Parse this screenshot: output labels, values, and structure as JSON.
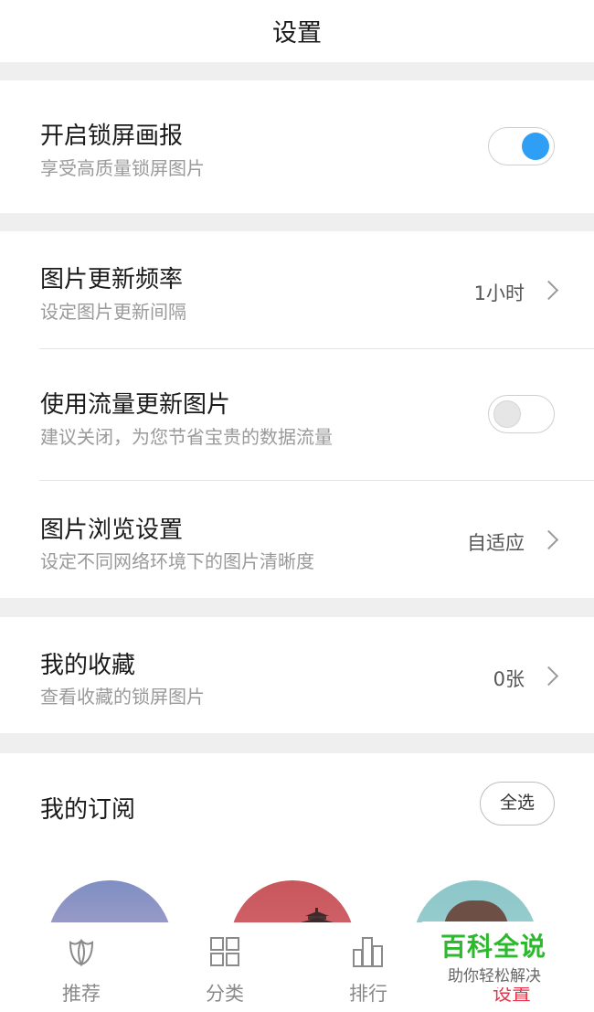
{
  "header": {
    "title": "设置"
  },
  "lockscreen": {
    "title": "开启锁屏画报",
    "subtitle": "享受高质量锁屏图片",
    "enabled": true
  },
  "update_frequency": {
    "title": "图片更新频率",
    "subtitle": "设定图片更新间隔",
    "value": "1小时"
  },
  "mobile_data": {
    "title": "使用流量更新图片",
    "subtitle": "建议关闭，为您节省宝贵的数据流量",
    "enabled": false
  },
  "browse_settings": {
    "title": "图片浏览设置",
    "subtitle": "设定不同网络环境下的图片清晰度",
    "value": "自适应"
  },
  "favorites": {
    "title": "我的收藏",
    "subtitle": "查看收藏的锁屏图片",
    "value": "0张"
  },
  "subscriptions": {
    "title": "我的订阅",
    "select_all_label": "全选"
  },
  "tabs": [
    {
      "label": "推荐",
      "icon": "tulip-icon"
    },
    {
      "label": "分类",
      "icon": "grid-icon"
    },
    {
      "label": "排行",
      "icon": "bar-chart-icon"
    },
    {
      "label": "设置",
      "icon": "gear-icon",
      "active": true
    }
  ],
  "watermark": {
    "title": "百科全说",
    "subtitle": "助你轻松解决"
  },
  "colors": {
    "accent": "#2f9ff5",
    "active_tab": "#e8334a",
    "watermark": "#2db92d"
  }
}
